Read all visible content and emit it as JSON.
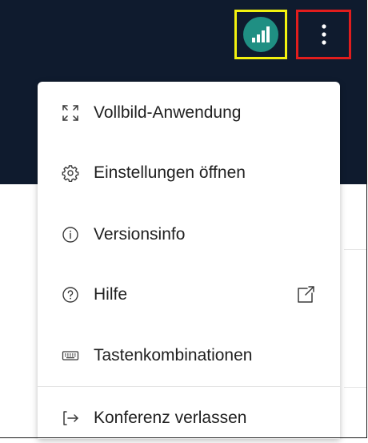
{
  "topbar": {
    "status_icon": "signal-bars-icon",
    "more_icon": "vertical-dots-icon",
    "status_highlight_color": "#f2f20f",
    "more_highlight_color": "#e11d1d",
    "status_color": "#1f8f83",
    "background_color": "#0f1b2e"
  },
  "menu": {
    "items": [
      {
        "label": "Vollbild-Anwendung",
        "icon": "fullscreen-icon"
      },
      {
        "label": "Einstellungen öffnen",
        "icon": "gear-icon"
      },
      {
        "label": "Versionsinfo",
        "icon": "info-icon"
      },
      {
        "label": "Hilfe",
        "icon": "help-icon",
        "trailing_icon": "external-link-icon"
      },
      {
        "label": "Tastenkombinationen",
        "icon": "keyboard-icon"
      },
      {
        "label": "Konferenz verlassen",
        "icon": "logout-icon"
      }
    ]
  }
}
